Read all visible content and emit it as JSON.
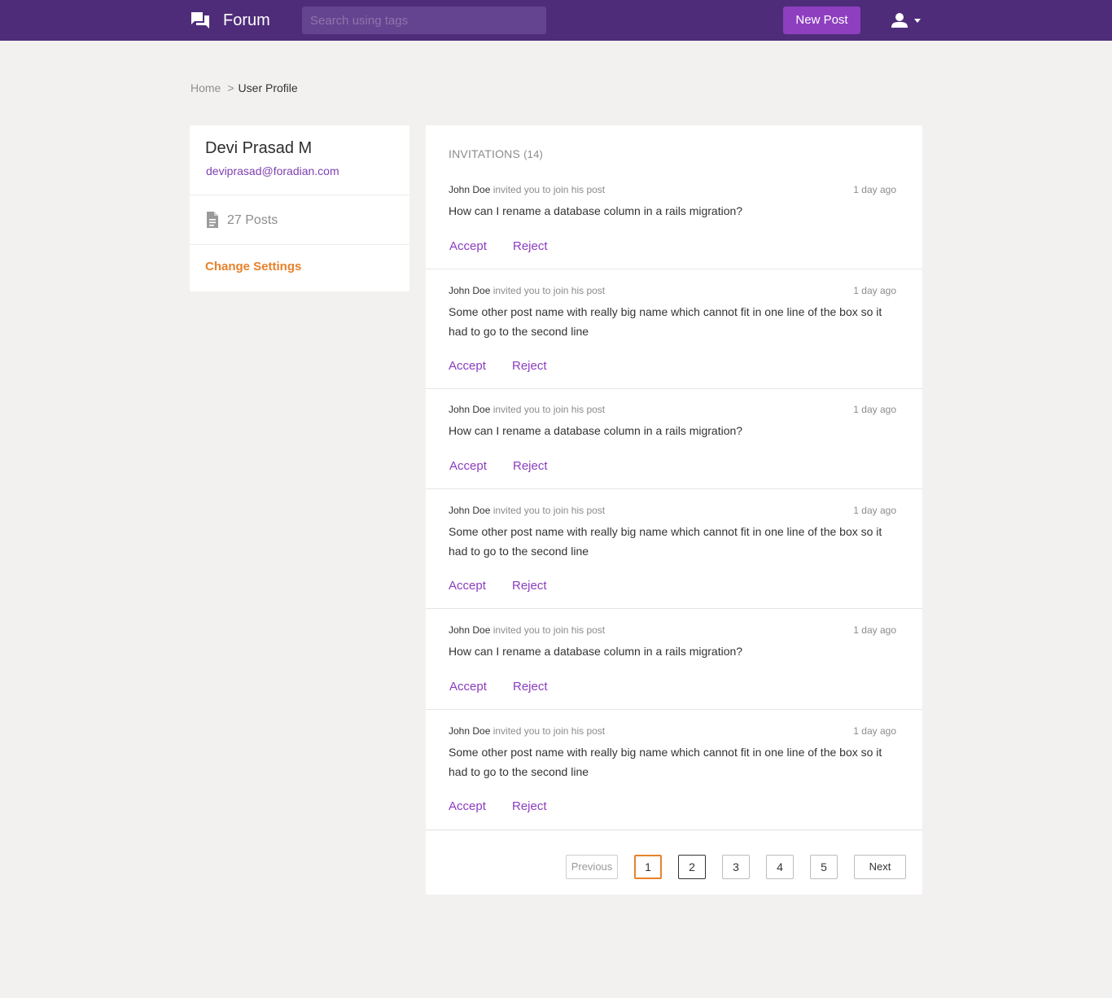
{
  "header": {
    "brand": "Forum",
    "search_placeholder": "Search using tags",
    "new_post_label": "New Post"
  },
  "breadcrumb": {
    "home": "Home",
    "separator": ">",
    "current": "User Profile"
  },
  "profile": {
    "name": "Devi Prasad M",
    "email": "deviprasad@foradian.com",
    "posts": "27 Posts",
    "settings": "Change Settings"
  },
  "invitations": {
    "title": "INVITATIONS",
    "count": "(14)",
    "items": [
      {
        "author": "John Doe",
        "action": "invited you to join his post",
        "time": "1 day ago",
        "text": "How can I rename a database column in a rails migration?",
        "accept": "Accept",
        "reject": "Reject"
      },
      {
        "author": "John Doe",
        "action": "invited you to join his post",
        "time": "1 day ago",
        "text": "Some other post name with really big name which cannot fit in one line of the box so it had to go to the second line",
        "accept": "Accept",
        "reject": "Reject"
      },
      {
        "author": "John Doe",
        "action": "invited you to join his post",
        "time": "1 day ago",
        "text": "How can I rename a database column in a rails migration?",
        "accept": "Accept",
        "reject": "Reject"
      },
      {
        "author": "John Doe",
        "action": "invited you to join his post",
        "time": "1 day ago",
        "text": "Some other post name with really big name which cannot fit in one line of the box so it had to go to the second line",
        "accept": "Accept",
        "reject": "Reject"
      },
      {
        "author": "John Doe",
        "action": "invited you to join his post",
        "time": "1 day ago",
        "text": "How can I rename a database column in a rails migration?",
        "accept": "Accept",
        "reject": "Reject"
      },
      {
        "author": "John Doe",
        "action": "invited you to join his post",
        "time": "1 day ago",
        "text": "Some other post name with really big name which cannot fit in one line of the box so it had to go to the second line",
        "accept": "Accept",
        "reject": "Reject"
      }
    ]
  },
  "pagination": {
    "previous": "Previous",
    "pages": [
      "1",
      "2",
      "3",
      "4",
      "5"
    ],
    "current_page": "1",
    "next": "Next"
  },
  "colors": {
    "header_bg": "#4f2c7a",
    "accent_purple": "#8e3fbf",
    "accent_orange": "#e8812a",
    "page_bg": "#f2f1f0"
  },
  "icons": {
    "logo": "forum-chat-icon",
    "user": "user-icon",
    "caret": "caret-down-icon",
    "posts": "document-icon"
  }
}
